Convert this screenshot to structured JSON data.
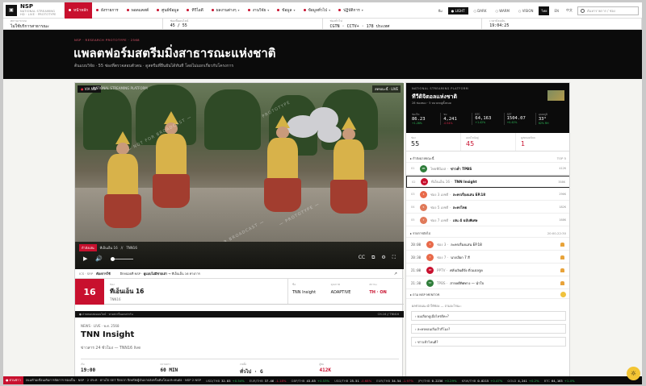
{
  "brand": {
    "name": "NSP",
    "sub": "NATIONAL STREAMING",
    "sub2": "HD · LIVE · PROTOTYPE"
  },
  "nav": [
    {
      "label": "หน้าหลัก",
      "active": true,
      "caret": false
    },
    {
      "label": "ผังรายการ",
      "active": false,
      "caret": false
    },
    {
      "label": "พอดแคสต์",
      "active": false,
      "caret": false
    },
    {
      "label": "ศูนย์ข้อมูล",
      "active": false,
      "caret": false
    },
    {
      "label": "ทีวีไอดี",
      "active": false,
      "caret": false
    },
    {
      "label": "ผลงานต่างๆ",
      "active": false,
      "caret": true
    },
    {
      "label": "งานวิจัย",
      "active": false,
      "caret": true
    },
    {
      "label": "ข้อมูล",
      "active": false,
      "caret": true
    },
    {
      "label": "ข้อมูลทั่วไป",
      "active": false,
      "caret": true
    },
    {
      "label": "ปฏิบัติการ",
      "active": false,
      "caret": true
    }
  ],
  "nav_right": {
    "prefix": "ธีม",
    "themes": [
      "LIGHT",
      "DARK",
      "WARM",
      "VISION"
    ],
    "active_theme": "LIGHT",
    "langs": [
      "ไทย",
      "EN",
      "中文"
    ],
    "active_lang": "ไทย",
    "search_placeholder": "ค้นหารายการ / ช่อง"
  },
  "infostrip": [
    {
      "label": "สถานะระบบ",
      "value": "ไม่ใช้บริการสาธารณะ"
    },
    {
      "label": "ช่องที่ออนไลน์",
      "value": "45 / 55"
    },
    {
      "label": "ช่องทั่วไป",
      "value": "CGTN · CCTV+ · 178 ประเทศ"
    },
    {
      "label": "เวลาปัจจุบัน",
      "value": "19:04:25"
    }
  ],
  "hero": {
    "kicker": "NSP · RESEARCH PROTOTYPE · 2568",
    "title": "แพลตฟอร์มสตรีมมิ่งสาธารณะแห่งชาติ",
    "subtitle": "ต้นแบบวิจัย · 55 ช่องที่ตรวจสอบตัวตน · ดูสตรีมที่ยืนยันได้ทันที โดยไม่แยกเกี่ยวกับโครงการ"
  },
  "player": {
    "live_tag": "VIA NSP",
    "live_label": "NATIONAL STREAMING PLATFORM",
    "top_right": "สดขณะนี้ · LIVE",
    "status": {
      "badge": "กำลังเล่น",
      "channel": "ทีเอ็นเอ็น 16",
      "sep": "//",
      "code": "TNN16"
    },
    "controls": {
      "play": "▶",
      "volume": "🔊",
      "subs": "CC",
      "pip": "⧉",
      "settings": "⚙",
      "fullscreen": "⛶"
    },
    "watermarks": [
      "— NOT FOR BROADCAST —",
      "PROTOTYPE",
      "— NOT FOR BROADCAST —",
      "— PROTOTYPE —"
    ]
  },
  "crumb": {
    "prefix": "ICS · SRP",
    "label": "ต้องการใช้",
    "group_prefix": "อีกหน่อยที่ NSP ·",
    "group": "ดูแบบไม่มีชายเล่า",
    "arrow_text": "→ ทีเอ็นเอ็น 16 ทางการ",
    "corner": "↗"
  },
  "channel": {
    "number": "16",
    "label": "ช่อง",
    "name": "ทีเอ็นเอ็น 16",
    "sub": "TNN16",
    "cells": [
      {
        "label": "ชื่อ",
        "value": "TNN Insight",
        "red": false
      },
      {
        "label": "คุณภาพ",
        "value": "ADAPTIVE",
        "red": false
      },
      {
        "label": "สถานะ",
        "value": "TH · ON",
        "red": true
      }
    ]
  },
  "dark_strip": {
    "left": "● ถ่ายทอดสดออนไลน์ · ทางสถานีนอกเท่ากัน",
    "right": "CH-16 // TNN16"
  },
  "program": {
    "news": "NEWS · LIVE · พ.ศ. 2568",
    "title": "TNN Insight",
    "desc": "ข่าวสาร 24 ชั่วโมง — TNN16 live",
    "grid": [
      {
        "label": "เริ่ม",
        "value": "19:00",
        "red": false
      },
      {
        "label": "ความยาว",
        "value": "60 MIN",
        "red": false
      },
      {
        "label": "เรตติ้ง",
        "value": "ทั่วไป · G",
        "red": false
      },
      {
        "label": "ผู้ชม",
        "value": "412K",
        "red": true
      }
    ]
  },
  "right": {
    "label": "NATIONAL STREAMING PLATFORM",
    "title": "ทีวีดิจิตอลแห่งชาติ",
    "sub": "28 ช่องทอง · 5 หมวดหมู่ทั้งหมด",
    "stats": [
      {
        "label": "ช่องไท",
        "value": "86.23",
        "change": "+1.28%",
        "dir": "up"
      },
      {
        "label": "ชม",
        "value": "4,241",
        "change": "-0.54%",
        "dir": "dn"
      },
      {
        "label": "BTC",
        "value": "64,163",
        "change": "+1.42%",
        "dir": "up"
      },
      {
        "label": "SET",
        "value": "1504.07",
        "change": "+0.42%",
        "dir": "up"
      },
      {
        "label": "อุณหภูมิ",
        "value": "33°",
        "change": "62% RH",
        "dir": "up"
      }
    ],
    "counts": [
      {
        "label": "ช่อง",
        "value": "55",
        "red": false
      },
      {
        "label": "ออนไลน์อยู่",
        "value": "45",
        "red": true
      },
      {
        "label": "ดูสดยอดนิยม",
        "value": "1",
        "red": true
      }
    ],
    "top_head": {
      "label": "▸ กำลังฉายขณะนี้",
      "right": "TOP 5"
    },
    "top": [
      {
        "rank": "01",
        "logo": "PB",
        "color": "#2f7d3a",
        "channel": "ไทยพีบีเอส ·",
        "show": "ข่าวค่ำ TPBS",
        "value": "412K",
        "sel": false
      },
      {
        "rank": "02",
        "logo": "16",
        "color": "#c8102e",
        "channel": "ทีเอ็นเอ็น 16 ·",
        "show": "TNN Insight",
        "value": "358K",
        "sel": true
      },
      {
        "rank": "03",
        "logo": "3",
        "color": "#e86a4a",
        "channel": "ช่อง 3 เอชดี ·",
        "show": "ละครเรื่องแสน EP.18",
        "value": "296K",
        "sel": false
      },
      {
        "rank": "04",
        "logo": "5",
        "color": "#e07a5a",
        "channel": "ช่อง 5 เอชดี ·",
        "show": "ละครไทย",
        "value": "182K",
        "sel": false
      },
      {
        "rank": "05",
        "logo": "7",
        "color": "#e07a5a",
        "channel": "ช่อง 7 เอชดี ·",
        "show": "เล่น 4 ฉบับพิเศษ",
        "value": "168K",
        "sel": false
      }
    ],
    "sched_head": {
      "label": "▸ รายการถัดไป",
      "right": "20:00-22:30"
    },
    "schedule": [
      {
        "time": "20:00",
        "logo": "3",
        "color": "#e86a4a",
        "channel": "ช่อง 3 ·",
        "show": "ละครเรื่องแสน EP.18"
      },
      {
        "time": "20:30",
        "logo": "7",
        "color": "#e86a4a",
        "channel": "ช่อง 7 ·",
        "show": "นางเงือก 7 สี"
      },
      {
        "time": "21:00",
        "logo": "PP",
        "color": "#c8102e",
        "channel": "PPTV ·",
        "show": "ศลับเงินดีจัง ติ่วแปลรูด"
      },
      {
        "time": "21:30",
        "logo": "TP",
        "color": "#2f7d3a",
        "channel": "TPBS ·",
        "show": "สารคดีทิศทาง — นำใจ"
      }
    ],
    "mentor": {
      "label": "▸ ถาม NSP MENTOR",
      "intro": "ผลช่วยแนะนำให้ช่อง — ถามอะไรนะ:",
      "questions": [
        "› ผมเลือกดูเมื่อไหร่ดีคะ?",
        "› ละครคอนเริ่มเร็วกี่โมง?",
        "› ข่าวเช้าไหนดี?"
      ]
    }
  },
  "ticker": {
    "badge": "● ด่วนข่าว",
    "headline": "ถนนห้ามเขื่อนเดิมการจัดการ ทองเป็น · NSP · 2 ประท · ผ่านไป SET ปิดบวก ปิดดปิดผู้เงินบาดส่งครั้งเดิมโน่นประทนต่อ · NSP 2 NSP",
    "items": [
      {
        "sym": "USD/THB",
        "price": "32.83",
        "chg": "+0.54%",
        "dir": "up"
      },
      {
        "sym": "EUR/THB",
        "price": "37.46",
        "chg": "-1.18%",
        "dir": "dn"
      },
      {
        "sym": "GBP/THB",
        "price": "43.85",
        "chg": "+0.53%",
        "dir": "up"
      },
      {
        "sym": "USD/THB",
        "price": "25.51",
        "chg": "-0.68%",
        "dir": "dn"
      },
      {
        "sym": "EUR/THB",
        "price": "34.54",
        "chg": "-1.97%",
        "dir": "dn"
      },
      {
        "sym": "JPY/THB",
        "price": "0.2236",
        "chg": "+0.29%",
        "dir": "up"
      },
      {
        "sym": "KRW/THB",
        "price": "0.0215",
        "chg": "+0.47%",
        "dir": "up"
      },
      {
        "sym": "GOLD",
        "price": "4,241",
        "chg": "+0.2%",
        "dir": "up"
      },
      {
        "sym": "BTC",
        "price": "64,163",
        "chg": "+1.4%",
        "dir": "up"
      }
    ]
  },
  "fab": {
    "label": "☼"
  }
}
